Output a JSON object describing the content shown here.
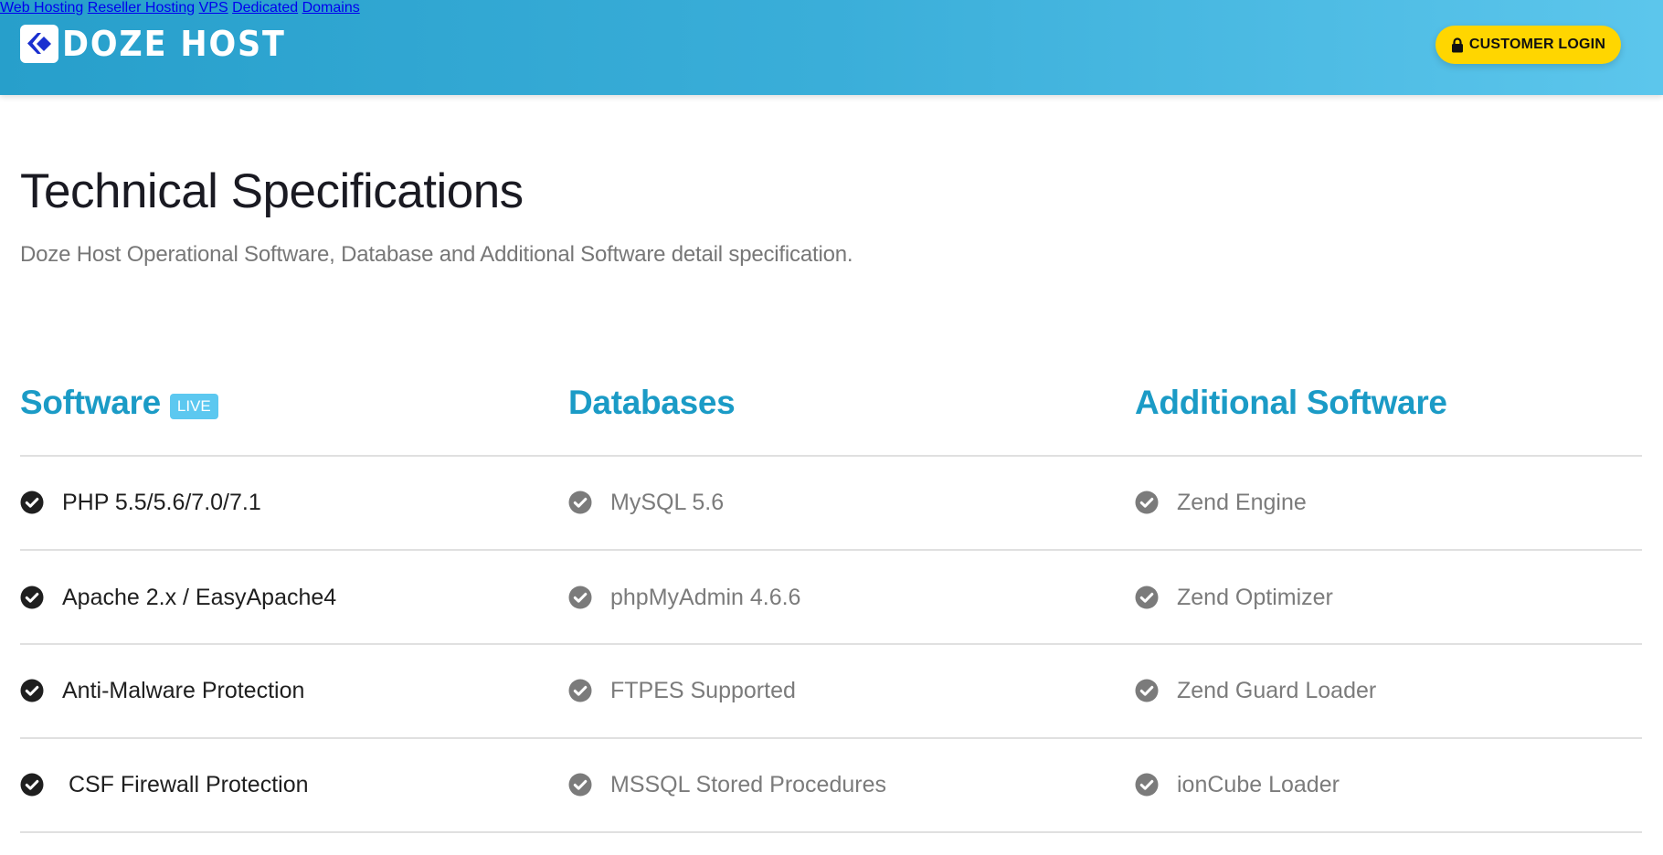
{
  "header": {
    "brand": "DOZE HOST",
    "logo_icon": "doze-host-chevron-diamond-icon",
    "nav": [
      {
        "label": "Web Hosting"
      },
      {
        "label": "Reseller Hosting"
      },
      {
        "label": "VPS"
      },
      {
        "label": "Dedicated"
      },
      {
        "label": "Domains"
      }
    ],
    "login": {
      "label": "CUSTOMER LOGIN",
      "icon": "lock-icon"
    },
    "colors": {
      "gradient_start": "#279fcb",
      "gradient_end": "#5cc6ec",
      "login_bg": "#ffd600",
      "logo_blue": "#1a2fd0"
    }
  },
  "page": {
    "title": "Technical Specifications",
    "subtitle": "Doze Host Operational Software, Database and Additional Software detail specification."
  },
  "columns": [
    {
      "heading": "Software",
      "badge": "LIVE",
      "style": "dark",
      "items": [
        "PHP 5.5/5.6/7.0/7.1",
        "Apache 2.x / EasyApache4",
        "Anti-Malware Protection",
        " CSF Firewall Protection"
      ]
    },
    {
      "heading": "Databases",
      "style": "gray",
      "items": [
        "MySQL 5.6",
        "phpMyAdmin 4.6.6",
        "FTPES Supported",
        "MSSQL Stored Procedures"
      ]
    },
    {
      "heading": "Additional Software",
      "style": "gray",
      "items": [
        "Zend Engine",
        "Zend Optimizer",
        "Zend Guard Loader",
        "ionCube Loader"
      ]
    }
  ],
  "colors": {
    "heading": "#1b9bc6",
    "badge": "#5cc8f0",
    "check_dark": "#1f1f1f",
    "check_gray": "#7b7b7b",
    "divider": "#e0e0e0"
  }
}
